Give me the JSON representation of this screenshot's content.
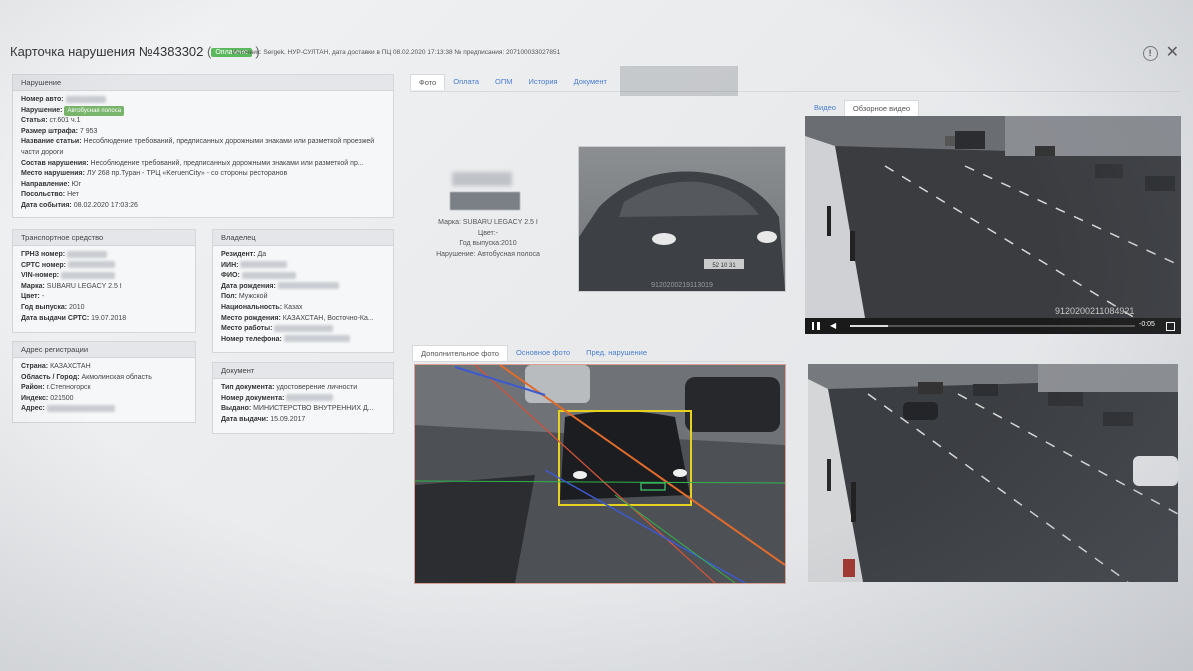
{
  "header": {
    "title": "Карточка нарушения №4383302",
    "status_badge": "Оплачено",
    "meta": "Источник: Sergek, НУР-СУЛТАН, дата доставки в ПЦ 08.02.2020 17:13:38   № предписания: 207100033027851"
  },
  "violation_panel": {
    "heading": "Нарушение",
    "rows": [
      {
        "k": "Номер авто:",
        "v": ""
      },
      {
        "k": "Нарушение:",
        "tag": "Автобусная полоса"
      },
      {
        "k": "Статья:",
        "v": "ст.601 ч.1"
      },
      {
        "k": "Размер штрафа:",
        "v": "7 953"
      },
      {
        "k": "Название статьи:",
        "v": "Несоблюдение требований, предписанных дорожными знаками или разметкой проезжей части дороги"
      },
      {
        "k": "Состав нарушения:",
        "v": "Несоблюдение требований, предписанных дорожными знаками или разметкой пр..."
      },
      {
        "k": "Место нарушения:",
        "v": "ЛУ 268 пр.Туран - ТРЦ «KeruenCity» - со стороны ресторанов"
      },
      {
        "k": "Направление:",
        "v": "Юг"
      },
      {
        "k": "Посольство:",
        "v": "Нет"
      },
      {
        "k": "Дата события:",
        "v": "08.02.2020 17:03:26"
      }
    ]
  },
  "vehicle_panel": {
    "heading": "Транспортное средство",
    "rows": [
      {
        "k": "ГРНЗ номер:",
        "v": ""
      },
      {
        "k": "СРТС номер:",
        "v": ""
      },
      {
        "k": "VIN-номер:",
        "v": ""
      },
      {
        "k": "Марка:",
        "v": "SUBARU LEGACY 2.5 I"
      },
      {
        "k": "Цвет:",
        "v": "-"
      },
      {
        "k": "Год выпуска:",
        "v": "2010"
      },
      {
        "k": "Дата выдачи СРТС:",
        "v": "19.07.2018"
      }
    ]
  },
  "owner_panel": {
    "heading": "Владелец",
    "rows": [
      {
        "k": "Резидент:",
        "v": "Да"
      },
      {
        "k": "ИИН:",
        "v": ""
      },
      {
        "k": "ФИО:",
        "v": ""
      },
      {
        "k": "Дата рождения:",
        "v": ""
      },
      {
        "k": "Пол:",
        "v": "Мужской"
      },
      {
        "k": "Национальность:",
        "v": "Казах"
      },
      {
        "k": "Место рождения:",
        "v": "КАЗАХСТАН, Восточно-Ка..."
      },
      {
        "k": "Место работы:",
        "v": ""
      },
      {
        "k": "Номер телефона:",
        "v": ""
      }
    ]
  },
  "address_panel": {
    "heading": "Адрес регистрации",
    "rows": [
      {
        "k": "Страна:",
        "v": "КАЗАХСТАН"
      },
      {
        "k": "Область / Город:",
        "v": "Акмолинская область"
      },
      {
        "k": "Район:",
        "v": "г.Степногорск"
      },
      {
        "k": "Индекс:",
        "v": "021500"
      },
      {
        "k": "Адрес:",
        "v": ""
      }
    ]
  },
  "document_panel": {
    "heading": "Документ",
    "rows": [
      {
        "k": "Тип документа:",
        "v": "удостоверение личности"
      },
      {
        "k": "Номер документа:",
        "v": ""
      },
      {
        "k": "Выдано:",
        "v": "МИНИСТЕРСТВО ВНУТРЕННИХ Д..."
      },
      {
        "k": "Дата выдачи:",
        "v": "15.09.2017"
      }
    ]
  },
  "top_tabs": [
    "Фото",
    "Оплата",
    "ОПМ",
    "История",
    "Документ"
  ],
  "car_info": {
    "make": "Марка: SUBARU LEGACY 2.5 I",
    "color": "Цвет:-",
    "year": "Год выпуска:2010",
    "violation": "Нарушение: Автобусная полоса"
  },
  "video_tabs": [
    "Видео",
    "Обзорное видео"
  ],
  "video_time": "-0:05",
  "video_stamp": "9120200211084921",
  "photo_stamp": "9120200219113019",
  "photo_tabs": [
    "Дополнительное фото",
    "Основное фото",
    "Пред. нарушение"
  ],
  "colors": {
    "badge": "#5cb85c",
    "link": "#4b7dd1"
  }
}
